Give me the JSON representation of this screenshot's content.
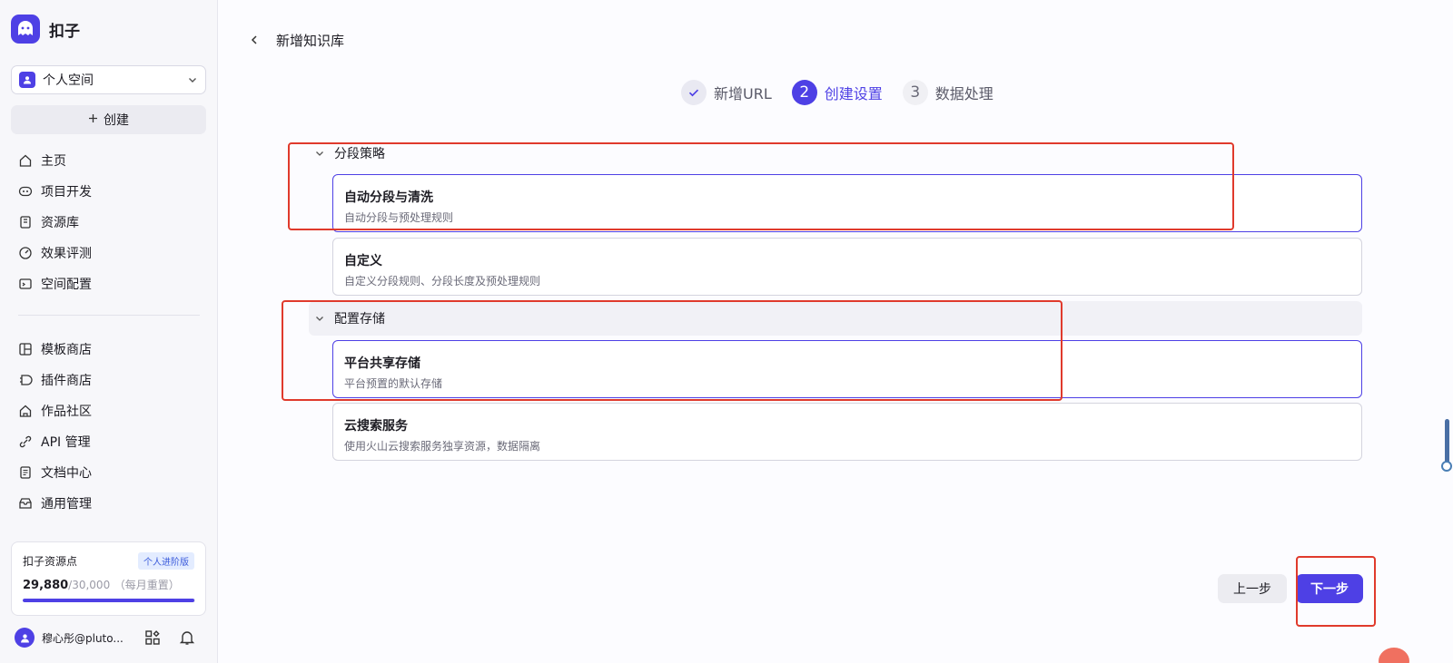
{
  "sidebar": {
    "brand": "扣子",
    "space": "个人空间",
    "create_label": "创建",
    "nav_primary": [
      {
        "label": "主页",
        "icon": "home-icon"
      },
      {
        "label": "项目开发",
        "icon": "project-icon"
      },
      {
        "label": "资源库",
        "icon": "library-icon"
      },
      {
        "label": "效果评测",
        "icon": "evaluation-icon"
      },
      {
        "label": "空间配置",
        "icon": "space-config-icon"
      }
    ],
    "nav_secondary": [
      {
        "label": "模板商店",
        "icon": "template-store-icon"
      },
      {
        "label": "插件商店",
        "icon": "plugin-store-icon"
      },
      {
        "label": "作品社区",
        "icon": "community-icon"
      },
      {
        "label": "API 管理",
        "icon": "api-icon"
      },
      {
        "label": "文档中心",
        "icon": "docs-icon"
      },
      {
        "label": "通用管理",
        "icon": "general-admin-icon"
      }
    ],
    "points": {
      "title": "扣子资源点",
      "badge": "个人进阶版",
      "value": "29,880",
      "total": "/30,000",
      "reset_note": "（每月重置）",
      "fill_fraction": 0.996
    },
    "user": {
      "name": "穆心彤@pluto..."
    }
  },
  "main": {
    "title": "新增知识库",
    "steps": [
      {
        "num": "",
        "label": "新增URL",
        "state": "done"
      },
      {
        "num": "2",
        "label": "创建设置",
        "state": "active"
      },
      {
        "num": "3",
        "label": "数据处理",
        "state": "todo"
      }
    ],
    "sections": [
      {
        "title": "分段策略",
        "options": [
          {
            "title": "自动分段与清洗",
            "desc": "自动分段与预处理规则",
            "selected": true
          },
          {
            "title": "自定义",
            "desc": "自定义分段规则、分段长度及预处理规则",
            "selected": false
          }
        ]
      },
      {
        "title": "配置存储",
        "options": [
          {
            "title": "平台共享存储",
            "desc": "平台预置的默认存储",
            "selected": true
          },
          {
            "title": "云搜索服务",
            "desc": "使用火山云搜索服务独享资源，数据隔离",
            "selected": false
          }
        ]
      }
    ],
    "prev_label": "上一步",
    "next_label": "下一步"
  },
  "colors": {
    "accent": "#4e40e5",
    "highlight": "#e03a2c"
  }
}
